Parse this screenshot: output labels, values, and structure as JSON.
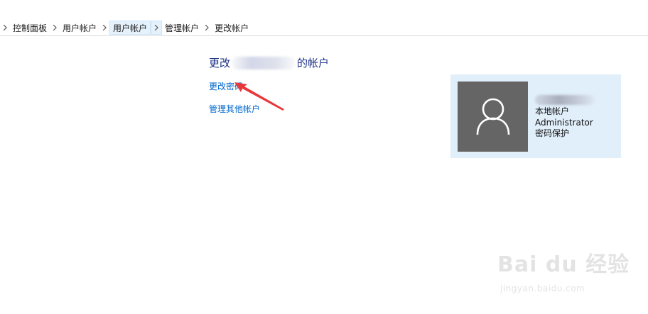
{
  "breadcrumb": {
    "items": [
      "控制面板",
      "用户帐户",
      "用户帐户",
      "管理帐户",
      "更改帐户"
    ]
  },
  "main": {
    "title_prefix": "更改",
    "title_suffix": "的帐户",
    "links": {
      "change_password": "更改密码",
      "manage_other_accounts": "管理其他帐户"
    }
  },
  "account_card": {
    "type": "本地帐户",
    "group": "Administrator",
    "protection": "密码保护",
    "avatar_icon": "user-icon",
    "background_color": "#e1effb",
    "avatar_color": "#656565"
  },
  "watermark": {
    "main": "Bai du 经验",
    "sub": "jingyan.baidu.com"
  },
  "colors": {
    "title": "#1e3287",
    "link": "#0066cc",
    "annotation_arrow": "#e8383b"
  }
}
